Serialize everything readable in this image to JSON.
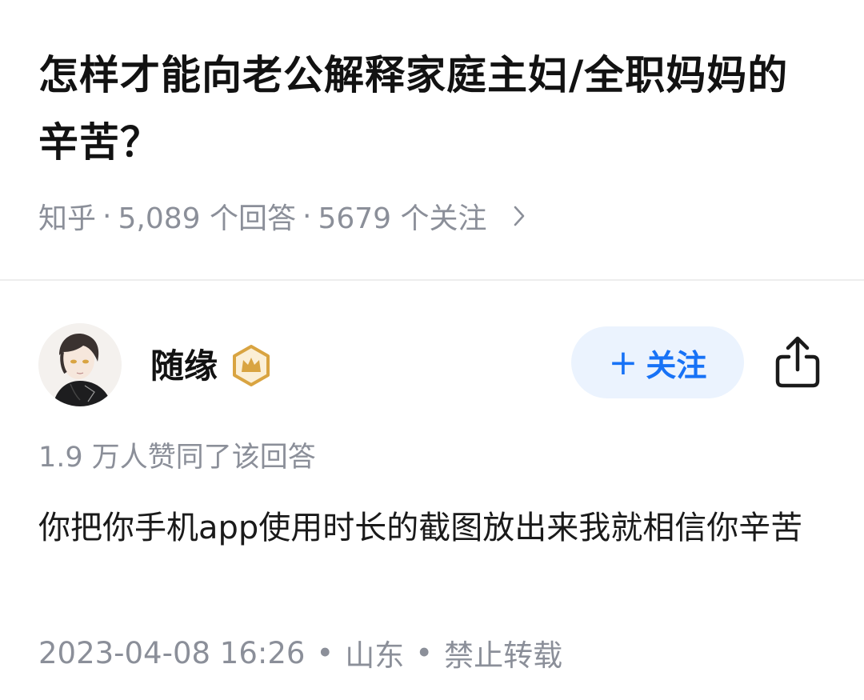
{
  "question": {
    "title": "怎样才能向老公解释家庭主妇/全职妈妈的辛苦？",
    "source": "知乎",
    "answers": "5,089 个回答",
    "followers": "5679 个关注",
    "separator": "·"
  },
  "answer": {
    "author": {
      "name": "随缘",
      "avatar_icon": "avatar-image",
      "badge_icon": "crown-badge-icon",
      "badge_color": "#d9a441"
    },
    "follow_button": {
      "plus": "+",
      "label": "关注",
      "color": "#1772f6",
      "background": "#ebf3fe"
    },
    "share_icon": "share-icon",
    "votes": "1.9 万人赞同了该回答",
    "content": "你把你手机app使用时长的截图放出来我就相信你辛苦",
    "date": "2023-04-08 16:26",
    "location": "山东",
    "copyright": "禁止转载",
    "dot": "•"
  }
}
